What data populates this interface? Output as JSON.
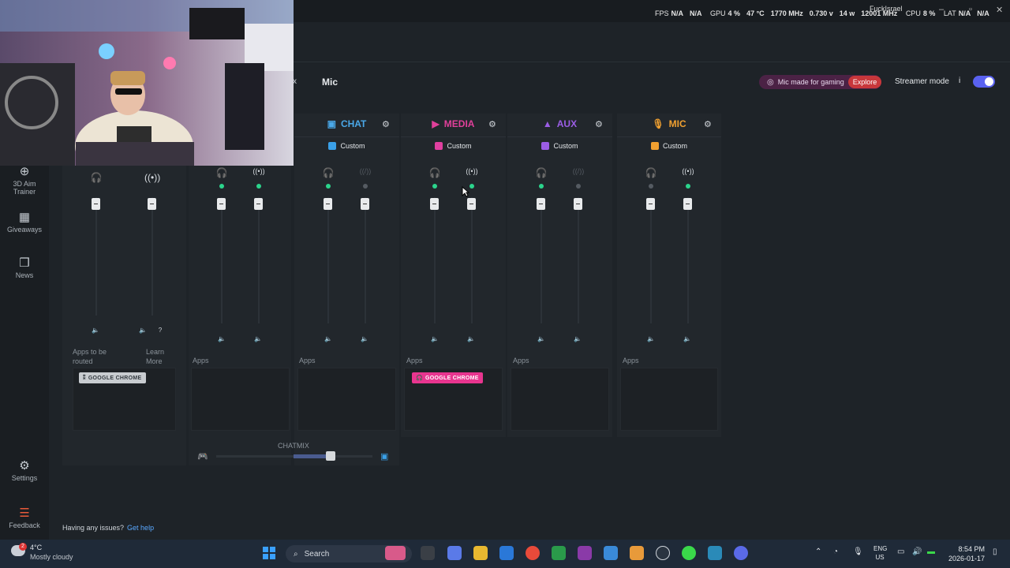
{
  "overlay": {
    "fps_label": "FPS",
    "fps_value1": "N/A",
    "fps_value2": "N/A",
    "gpu_label": "GPU",
    "gpu_usage": "4 %",
    "gpu_temp": "47 °C",
    "gpu_clock": "1770 MHz",
    "gpu_voltage": "0.730 v",
    "gpu_power": "14 w",
    "gpu_mem": "12001 MHz",
    "cpu_label": "CPU",
    "cpu_usage": "8 %",
    "lat_label": "LAT",
    "lat_value1": "N/A",
    "lat_value2": "N/A",
    "username": "FuckIsrael"
  },
  "header": {
    "close_glyph": "x",
    "device_title": "Mic",
    "promo_text": "Mic made for gaming",
    "promo_cta": "Explore",
    "streamer_mode_label": "Streamer mode",
    "info_glyph": "i",
    "streamer_mode_on": true
  },
  "sidebar": {
    "items": [
      {
        "label_line1": "3D Aim",
        "label_line2": "Trainer",
        "icon": "crosshair-icon"
      },
      {
        "label": "Giveaways",
        "icon": "gift-icon"
      },
      {
        "label": "News",
        "icon": "book-icon"
      },
      {
        "label": "Settings",
        "icon": "gear-icon"
      },
      {
        "label": "Feedback",
        "icon": "feedback-icon"
      }
    ]
  },
  "channels": [
    {
      "name": "CHAT",
      "color": "#4aa8e8",
      "mode": "Custom",
      "mode_color": "#3aa0e8",
      "apps_label": "Apps"
    },
    {
      "name": "MEDIA",
      "color": "#e0409a",
      "mode": "Custom",
      "mode_color": "#e040a0",
      "apps_label": "Apps",
      "app_chip": "GOOGLE CHROME"
    },
    {
      "name": "AUX",
      "color": "#9b5de5",
      "mode": "Custom",
      "mode_color": "#9b5de5",
      "apps_label": "Apps"
    },
    {
      "name": "MIC",
      "color": "#f0a030",
      "mode": "Custom",
      "mode_color": "#f0a030",
      "apps_label": "Apps"
    }
  ],
  "master": {
    "apps_to_route": "Apps to be routed",
    "learn_more_line1": "Learn",
    "learn_more_line2": "More",
    "app_chip": "GOOGLE CHROME"
  },
  "game": {
    "apps_label": "Apps"
  },
  "chatmix": {
    "label": "CHATMIX"
  },
  "footer": {
    "issues_text": "Having any issues?",
    "help_link": "Get help"
  },
  "taskbar": {
    "weather_temp": "4°C",
    "weather_desc": "Mostly cloudy",
    "weather_badge": "2",
    "search_placeholder": "Search",
    "lang_line1": "ENG",
    "lang_line2": "US",
    "time": "8:54 PM",
    "date": "2026-01-17"
  }
}
